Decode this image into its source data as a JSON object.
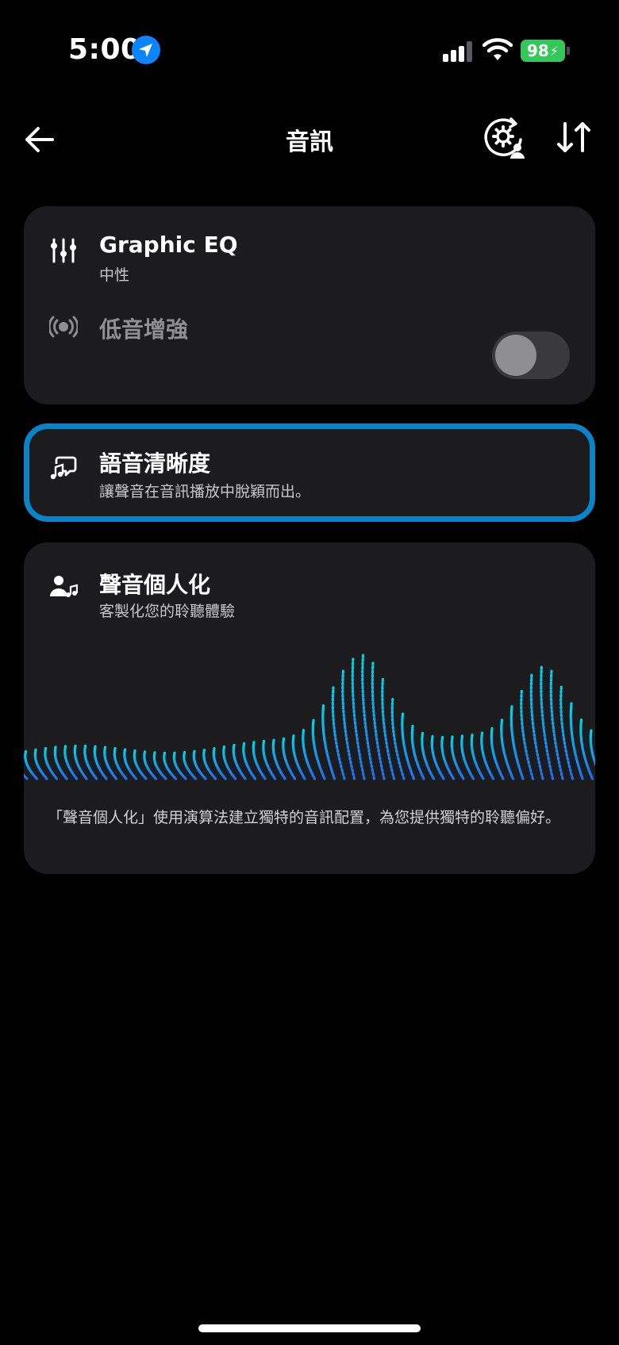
{
  "status_bar": {
    "time": "5:00",
    "battery": "98",
    "icons": [
      "location-arrow-icon",
      "signal-icon",
      "wifi-icon",
      "battery-charging-icon"
    ],
    "battery_color": "#34c759"
  },
  "nav": {
    "title": "音訊",
    "back_icon": "arrow-left-icon",
    "profile_icon": "profile-gear-icon",
    "sort_icon": "sort-arrows-icon"
  },
  "eq_card": {
    "eq_title": "Graphic EQ",
    "eq_subtitle": "中性",
    "bass_label": "低音增強",
    "bass_enabled": false
  },
  "voice_card": {
    "title": "語音清晰度",
    "subtitle": "讓聲音在音訊播放中脫穎而出。",
    "border_color": "#0a84c8"
  },
  "personal_card": {
    "title": "聲音個人化",
    "subtitle": "客製化您的聆聽體驗",
    "description": "「聲音個人化」使用演算法建立獨特的音訊配置，為您提供獨特的聆聽偏好。",
    "wave_colors": [
      "#1e6ff0",
      "#00d4e8"
    ]
  }
}
